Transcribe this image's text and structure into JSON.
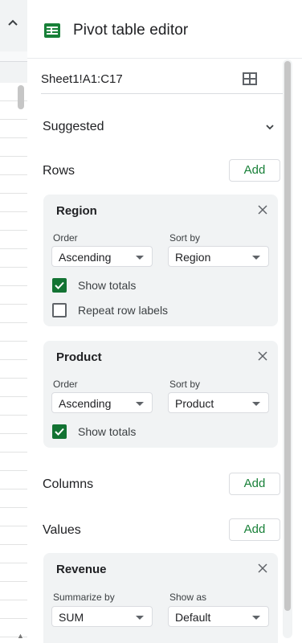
{
  "header": {
    "title": "Pivot table editor",
    "icon": "sheets-icon"
  },
  "range": {
    "value": "Sheet1!A1:C17"
  },
  "sections": {
    "suggested": "Suggested",
    "rows": "Rows",
    "columns": "Columns",
    "values": "Values",
    "add_label": "Add"
  },
  "row_cards": [
    {
      "title": "Region",
      "order_label": "Order",
      "order_value": "Ascending",
      "sort_label": "Sort by",
      "sort_value": "Region",
      "show_totals_label": "Show totals",
      "show_totals": true,
      "repeat_label": "Repeat row labels",
      "repeat": false
    },
    {
      "title": "Product",
      "order_label": "Order",
      "order_value": "Ascending",
      "sort_label": "Sort by",
      "sort_value": "Product",
      "show_totals_label": "Show totals",
      "show_totals": true
    }
  ],
  "value_card": {
    "title": "Revenue",
    "summarize_label": "Summarize by",
    "summarize_value": "SUM",
    "showas_label": "Show as",
    "showas_value": "Default"
  },
  "colors": {
    "accent": "#188038",
    "checkbox": "#137333",
    "card_bg": "#f1f3f4"
  }
}
